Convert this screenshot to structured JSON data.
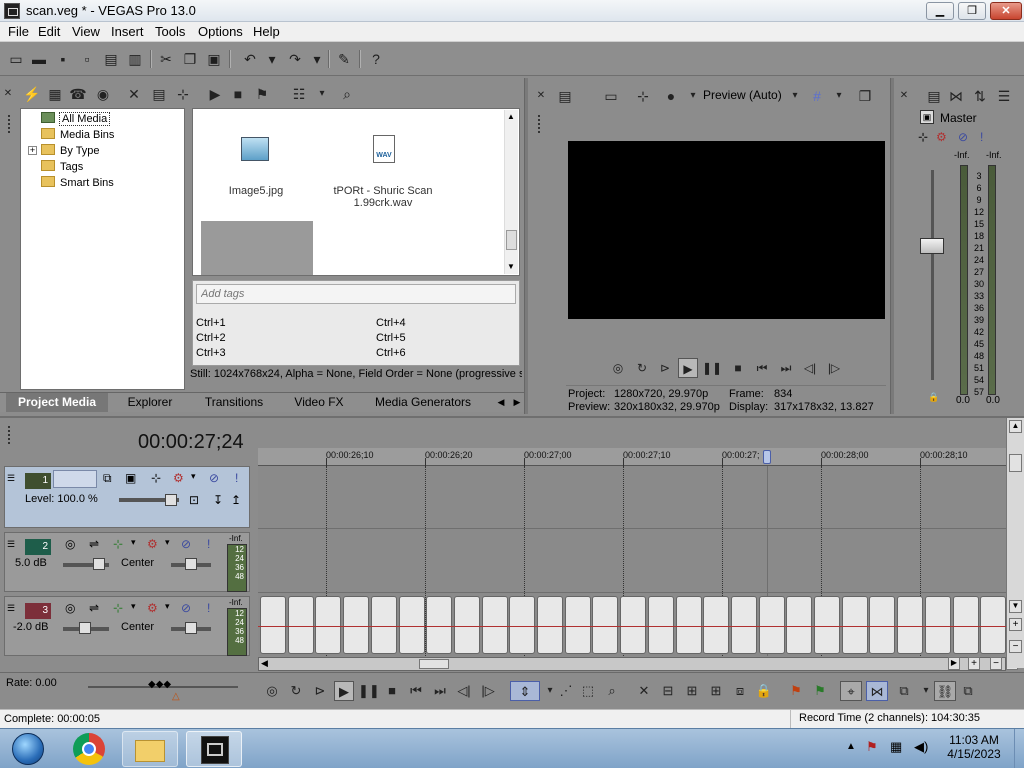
{
  "window": {
    "title": "scan.veg * - VEGAS Pro 13.0"
  },
  "menu": [
    "File",
    "Edit",
    "View",
    "Insert",
    "Tools",
    "Options",
    "Help"
  ],
  "project_media": {
    "tree": [
      "All Media",
      "Media Bins",
      "By Type",
      "Tags",
      "Smart Bins"
    ],
    "files": [
      {
        "name": "Image5.jpg",
        "icon": "image-file-icon"
      },
      {
        "name": "tPORt - Shuric Scan 1.99crk.wav",
        "icon": "wav-file-icon"
      }
    ],
    "tag_placeholder": "Add tags",
    "shortcuts": [
      "Ctrl+1",
      "Ctrl+4",
      "Ctrl+2",
      "Ctrl+5",
      "Ctrl+3",
      "Ctrl+6"
    ],
    "status": "Still: 1024x768x24, Alpha = None, Field Order = None (progressive s"
  },
  "dock_tabs": [
    "Project Media",
    "Explorer",
    "Transitions",
    "Video FX",
    "Media Generators"
  ],
  "preview": {
    "quality": "Preview (Auto)",
    "project_label": "Project:",
    "project_value": "1280x720, 29.970p",
    "preview_label": "Preview:",
    "preview_value": "320x180x32, 29.970p",
    "frame_label": "Frame:",
    "frame_value": "834",
    "display_label": "Display:",
    "display_value": "317x178x32, 13.827"
  },
  "master": {
    "title": "Master",
    "inf_left": "-Inf.",
    "inf_right": "-Inf.",
    "scale": [
      "3",
      "6",
      "9",
      "12",
      "15",
      "18",
      "21",
      "24",
      "27",
      "30",
      "33",
      "36",
      "39",
      "42",
      "45",
      "48",
      "51",
      "54",
      "57"
    ],
    "value_left": "0.0",
    "value_right": "0.0"
  },
  "timeline": {
    "timecode": "00:00:27;24",
    "ruler": [
      "00:00:26;10",
      "00:00:26;20",
      "00:00:27;00",
      "00:00:27;10",
      "00:00:27;",
      "00:00:28;00",
      "00:00:28;10"
    ],
    "tracks": [
      {
        "number": "1",
        "type": "video",
        "level": "Level: 100.0 %"
      },
      {
        "number": "2",
        "type": "audio",
        "volume": "5.0 dB",
        "pan": "Center",
        "meter_top": "-Inf.",
        "meter": "12\n24\n36\n48"
      },
      {
        "number": "3",
        "type": "audio",
        "volume": "-2.0 dB",
        "pan": "Center",
        "meter_top": "-Inf.",
        "meter": "12\n24\n36\n48"
      }
    ],
    "rate": "Rate: 0.00"
  },
  "status": {
    "left": "Complete: 00:00:05",
    "right": "Record Time (2 channels): 104:30:35"
  },
  "taskbar": {
    "time": "11:03 AM",
    "date": "4/15/2023"
  },
  "colors": {
    "panel": "#8c8c8c",
    "video_track": "#b4c4d8",
    "accent_red": "#b03030"
  }
}
